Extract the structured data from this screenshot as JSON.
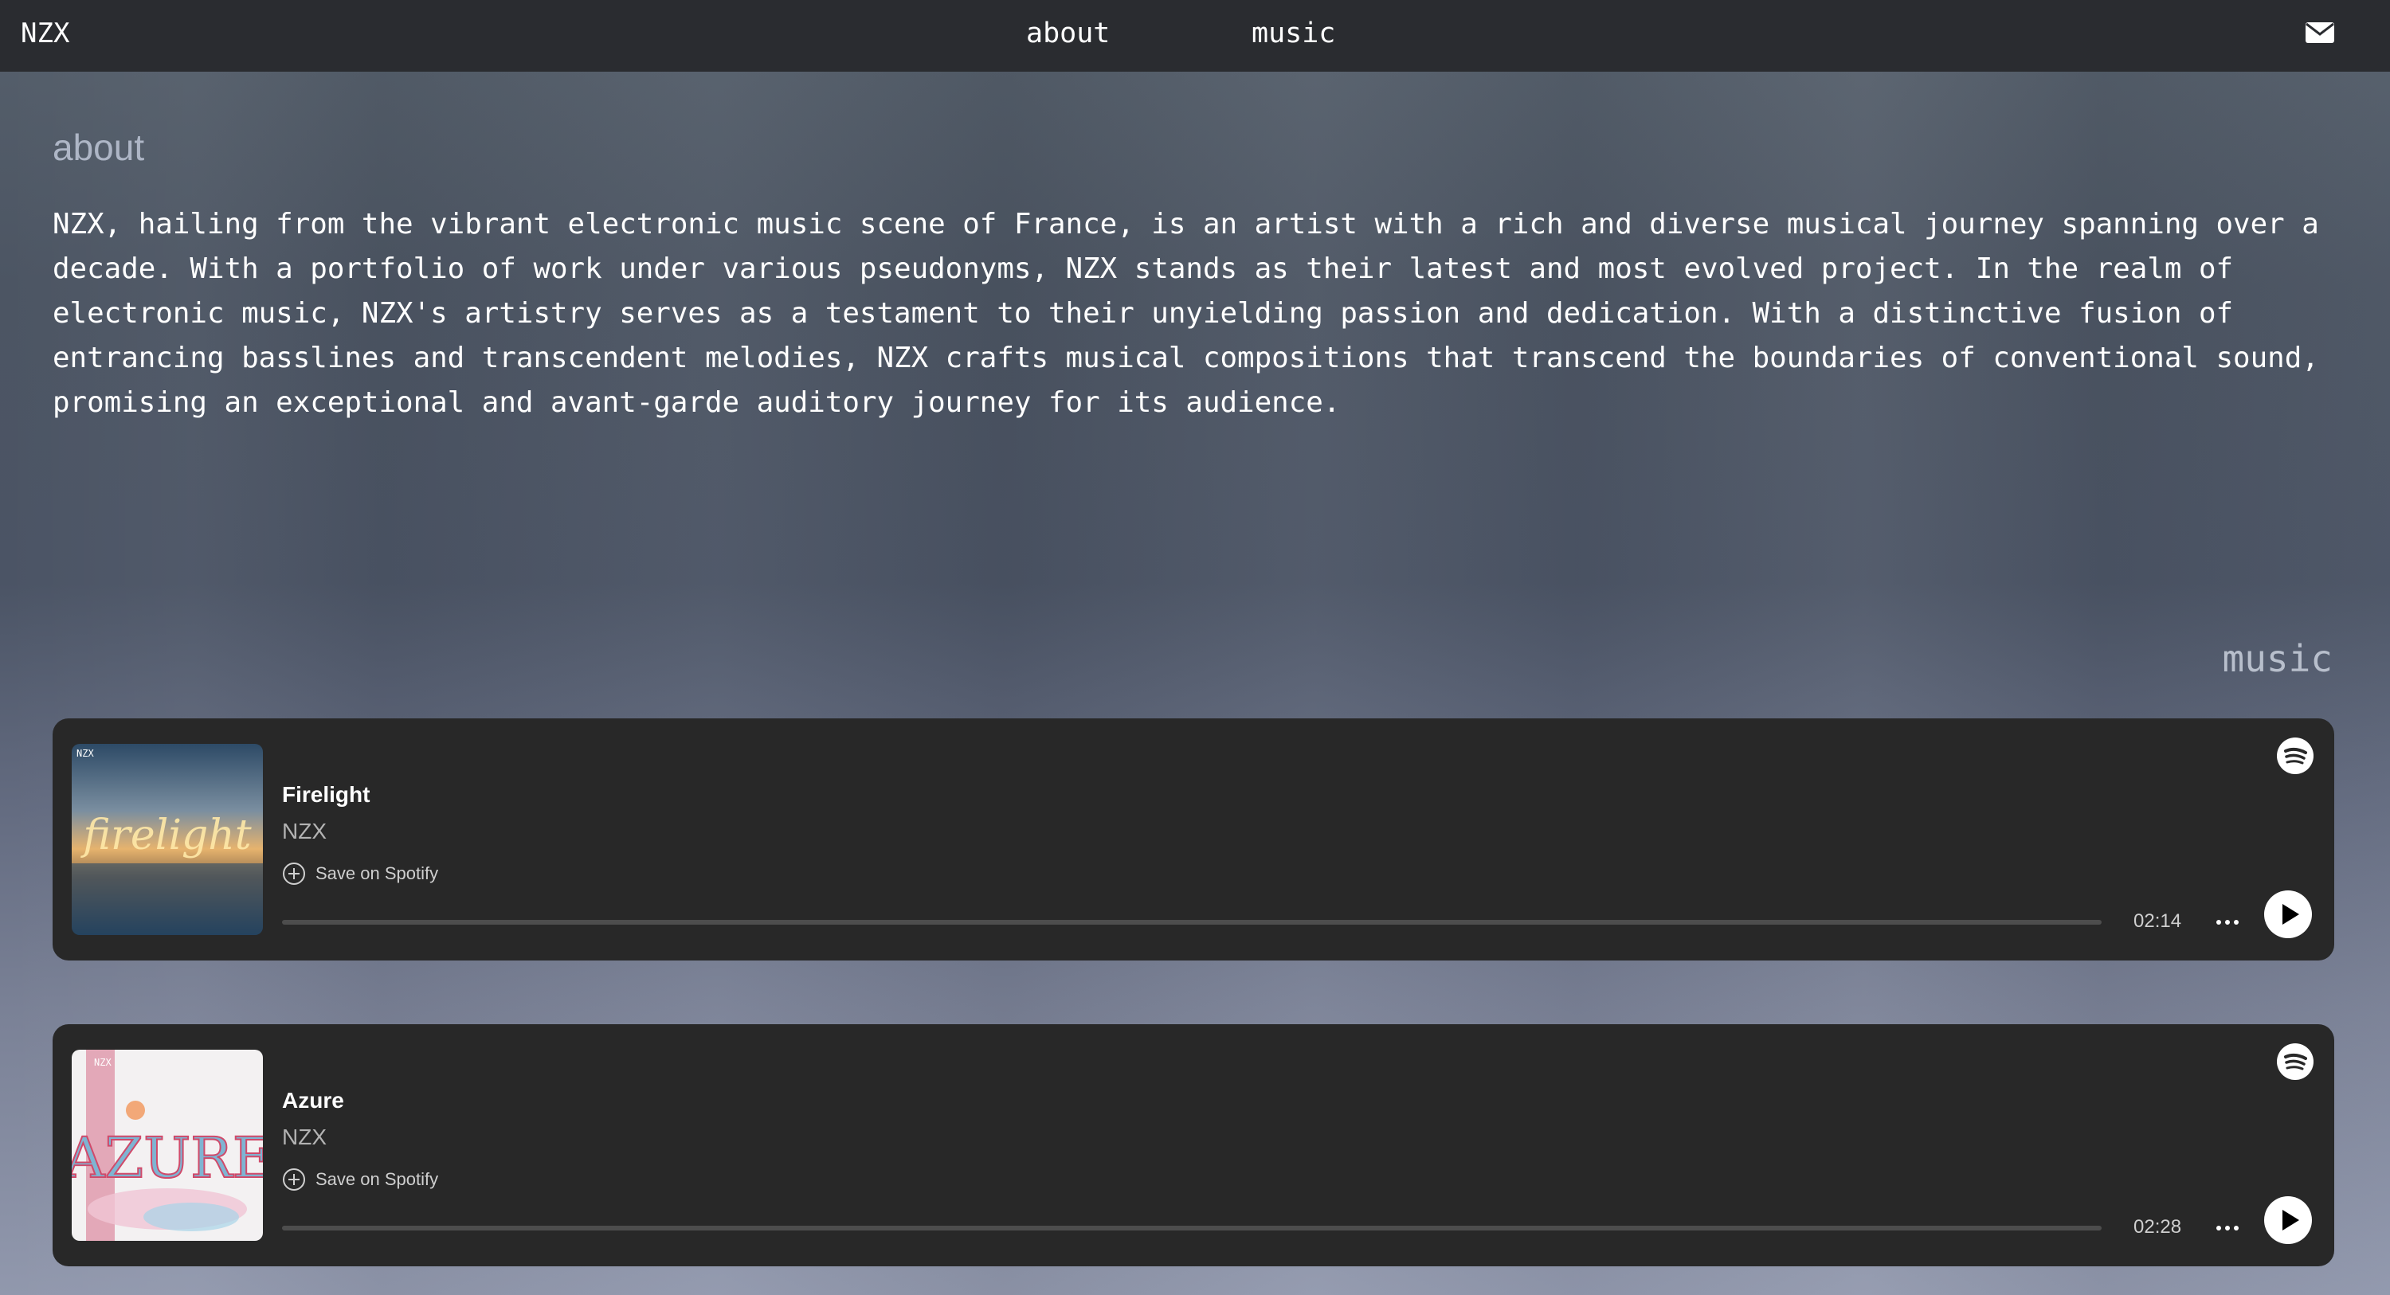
{
  "nav": {
    "brand": "NZX",
    "links": [
      {
        "label": "about"
      },
      {
        "label": "music"
      }
    ],
    "mail_icon": "envelope-icon"
  },
  "about": {
    "heading": "about",
    "text": "NZX, hailing from the vibrant electronic music scene of France, is an artist with a rich and diverse musical journey spanning over a decade. With a portfolio of work under various pseudonyms, NZX stands as their latest and most evolved project. In the realm of electronic music, NZX's artistry serves as a testament to their unyielding passion and dedication. With a distinctive fusion of entrancing basslines and transcendent melodies, NZX crafts musical compositions that transcend the boundaries of conventional sound, promising an exceptional and avant-garde auditory journey for its audience."
  },
  "music": {
    "heading": "music",
    "tracks": [
      {
        "title": "Firelight",
        "artist": "NZX",
        "save_label": "Save on Spotify",
        "duration": "02:14",
        "progress": 0,
        "cover_text": "firelight",
        "cover_badge": "NZX"
      },
      {
        "title": "Azure",
        "artist": "NZX",
        "save_label": "Save on Spotify",
        "duration": "02:28",
        "progress": 0,
        "cover_text": "AZURE",
        "cover_badge": "NZX"
      }
    ]
  },
  "colors": {
    "topbar": "#2a2c30",
    "card": "#282828",
    "text": "#ffffff",
    "muted": "#b3b3b3"
  }
}
